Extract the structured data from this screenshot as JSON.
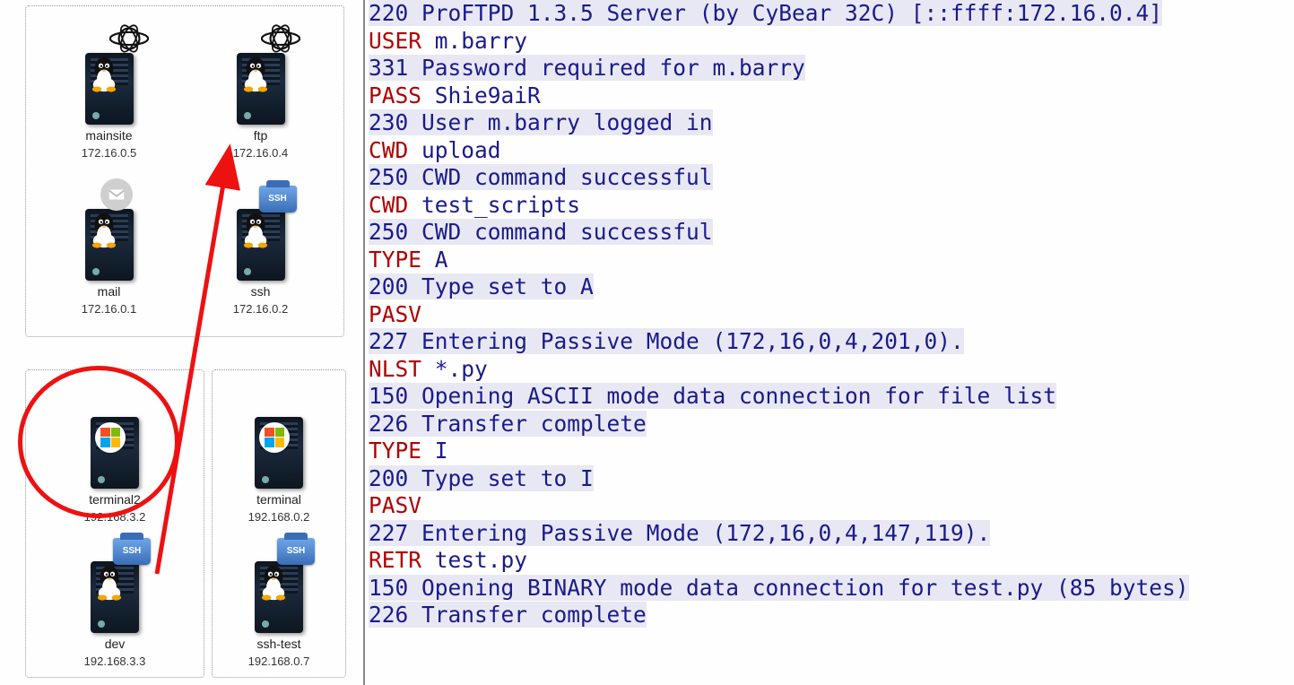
{
  "network": {
    "group1": [
      {
        "name": "mainsite",
        "ip": "172.16.0.5",
        "os": "linux",
        "badge": "globe"
      },
      {
        "name": "ftp",
        "ip": "172.16.0.4",
        "os": "linux",
        "badge": "globe"
      },
      {
        "name": "mail",
        "ip": "172.16.0.1",
        "os": "linux",
        "badge": "mail"
      },
      {
        "name": "ssh",
        "ip": "172.16.0.2",
        "os": "linux",
        "badge": "ssh"
      }
    ],
    "group2": [
      {
        "name": "terminal2",
        "ip": "192.168.3.2",
        "os": "windows",
        "badge": ""
      },
      {
        "name": "dev",
        "ip": "192.168.3.3",
        "os": "linux",
        "badge": "ssh"
      }
    ],
    "group3": [
      {
        "name": "terminal",
        "ip": "192.168.0.2",
        "os": "windows",
        "badge": ""
      },
      {
        "name": "ssh-test",
        "ip": "192.168.0.7",
        "os": "linux",
        "badge": "ssh"
      }
    ],
    "highlighted_host": "terminal2",
    "arrow_from": "terminal2",
    "arrow_to": "ftp"
  },
  "ftp_session": [
    {
      "t": "resp",
      "text": "220 ProFTPD 1.3.5 Server (by CyBear 32C) [::ffff:172.16.0.4]"
    },
    {
      "t": "cmd",
      "cmd": "USER",
      "arg": "m.barry"
    },
    {
      "t": "resp",
      "text": "331 Password required for m.barry"
    },
    {
      "t": "cmd",
      "cmd": "PASS",
      "arg": "Shie9aiR"
    },
    {
      "t": "resp",
      "text": "230 User m.barry logged in"
    },
    {
      "t": "cmd",
      "cmd": "CWD",
      "arg": "upload"
    },
    {
      "t": "resp",
      "text": "250 CWD command successful"
    },
    {
      "t": "cmd",
      "cmd": "CWD",
      "arg": "test_scripts"
    },
    {
      "t": "resp",
      "text": "250 CWD command successful"
    },
    {
      "t": "cmd",
      "cmd": "TYPE",
      "arg": "A"
    },
    {
      "t": "resp",
      "text": "200 Type set to A"
    },
    {
      "t": "cmd",
      "cmd": "PASV",
      "arg": ""
    },
    {
      "t": "resp",
      "text": "227 Entering Passive Mode (172,16,0,4,201,0)."
    },
    {
      "t": "cmd",
      "cmd": "NLST",
      "arg": "*.py"
    },
    {
      "t": "resp",
      "text": "150 Opening ASCII mode data connection for file list"
    },
    {
      "t": "resp",
      "text": "226 Transfer complete"
    },
    {
      "t": "cmd",
      "cmd": "TYPE",
      "arg": "I"
    },
    {
      "t": "resp",
      "text": "200 Type set to I"
    },
    {
      "t": "cmd",
      "cmd": "PASV",
      "arg": ""
    },
    {
      "t": "resp",
      "text": "227 Entering Passive Mode (172,16,0,4,147,119)."
    },
    {
      "t": "cmd",
      "cmd": "RETR",
      "arg": "test.py"
    },
    {
      "t": "resp",
      "text": "150 Opening BINARY mode data connection for test.py (85 bytes)"
    },
    {
      "t": "resp",
      "text": "226 Transfer complete"
    }
  ],
  "badge_labels": {
    "ssh": "SSH"
  }
}
